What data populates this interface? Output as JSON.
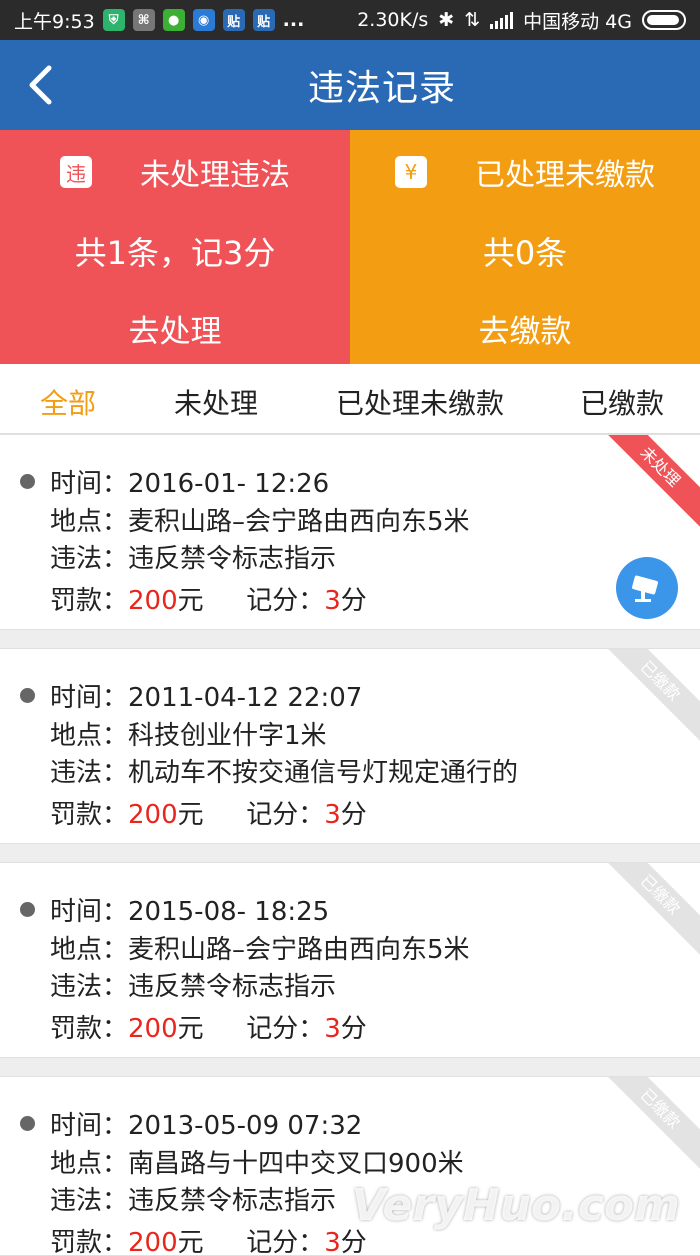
{
  "status_bar": {
    "time": "上午9:53",
    "net_speed": "2.30K/s",
    "carrier": "中国移动 4G",
    "app_badges": [
      "贴",
      "贴"
    ],
    "more": "..."
  },
  "header": {
    "title": "违法记录",
    "back_icon": "chevron-left-icon"
  },
  "summary": {
    "unprocessed": {
      "badge": "违",
      "title": "未处理违法",
      "summary": "共1条，记3分",
      "action": "去处理",
      "color": "#ef5357"
    },
    "processed_unpaid": {
      "badge": "¥",
      "title": "已处理未缴款",
      "summary": "共0条",
      "action": "去缴款",
      "color": "#f39d12"
    }
  },
  "tabs": [
    {
      "label": "全部",
      "active": true
    },
    {
      "label": "未处理",
      "active": false
    },
    {
      "label": "已处理未缴款",
      "active": false
    },
    {
      "label": "已缴款",
      "active": false
    }
  ],
  "labels": {
    "time": "时间：",
    "place": "地点：",
    "violation": "违法：",
    "fine": "罚款：",
    "points": "记分：",
    "yuan": "元",
    "fen": "分"
  },
  "records": [
    {
      "time": "2016-01-  12:26",
      "place": "麦积山路–会宁路由西向东5米",
      "violation": "违反禁令标志指示",
      "fine": "200",
      "points": "3",
      "status": "未处理"
    },
    {
      "time": "2011-04-12 22:07",
      "place": "科技创业什字1米",
      "violation": "机动车不按交通信号灯规定通行的",
      "fine": "200",
      "points": "3",
      "status": "已缴款"
    },
    {
      "time": "2015-08-  18:25",
      "place": "麦积山路–会宁路由西向东5米",
      "violation": "违反禁令标志指示",
      "fine": "200",
      "points": "3",
      "status": "已缴款"
    },
    {
      "time": "2013-05-09 07:32",
      "place": "南昌路与十四中交叉口900米",
      "violation": "违反禁令标志指示",
      "fine": "200",
      "points": "3",
      "status": "已缴款"
    }
  ],
  "watermark": "VeryHuo.com"
}
